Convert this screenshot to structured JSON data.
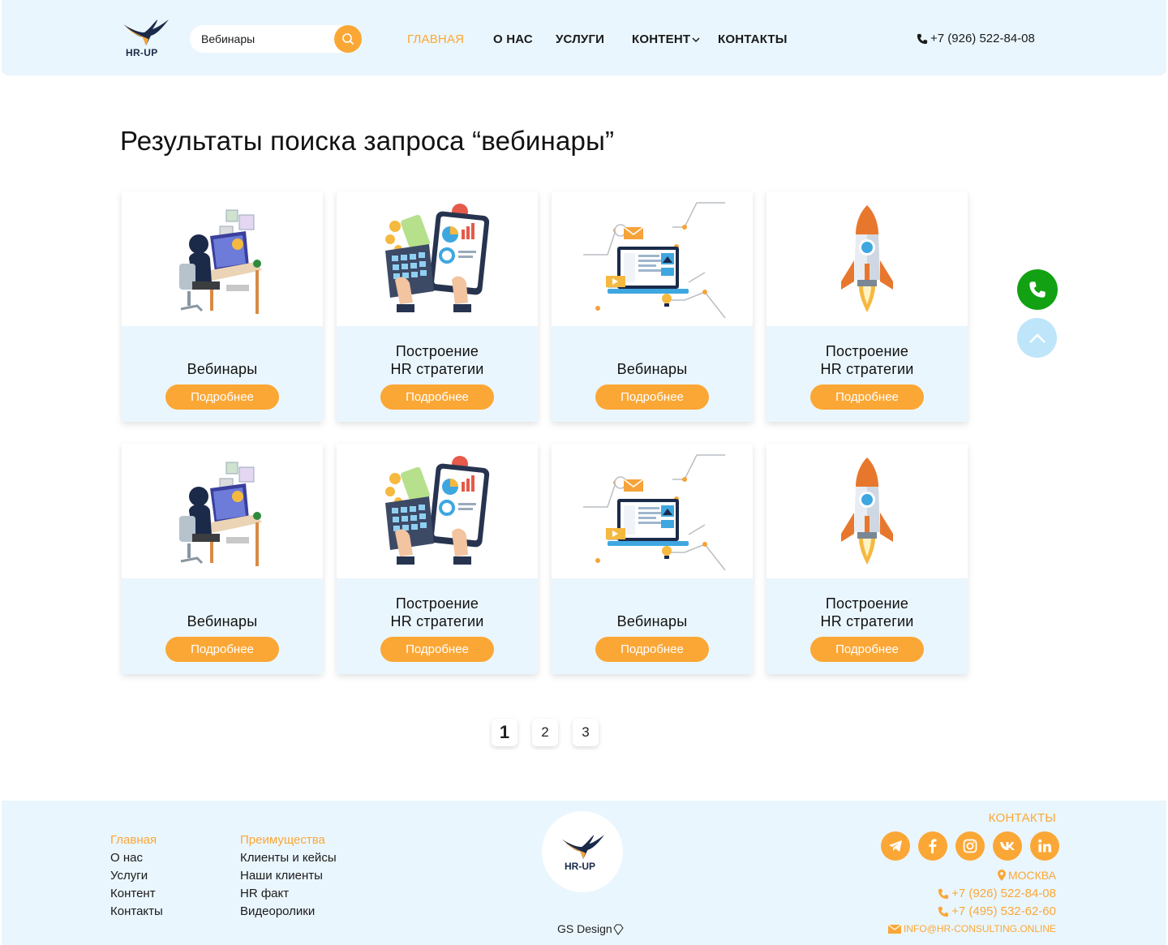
{
  "header": {
    "logo_text": "HR-UP",
    "search": {
      "value": "Вебинары"
    },
    "nav": [
      {
        "label": "ГЛАВНАЯ",
        "active": true
      },
      {
        "label": "О НАС"
      },
      {
        "label": "УСЛУГИ"
      },
      {
        "label": "КОНТЕНТ"
      },
      {
        "label": "КОНТАКТЫ"
      }
    ],
    "phone": "+7 (926) 522-84-08"
  },
  "main": {
    "title": "Результаты поиска запроса “вебинары”",
    "cards": [
      {
        "title": "Вебинары",
        "button": "Подробнее",
        "image": "office-worker-illustration"
      },
      {
        "title": "Построение\nHR стратегии",
        "button": "Подробнее",
        "image": "analytics-tablet-illustration"
      },
      {
        "title": "Вебинары",
        "button": "Подробнее",
        "image": "laptop-network-illustration"
      },
      {
        "title": "Построение\nHR стратегии",
        "button": "Подробнее",
        "image": "rocket-illustration"
      },
      {
        "title": "Вебинары",
        "button": "Подробнее",
        "image": "office-worker-illustration"
      },
      {
        "title": "Построение\nHR стратегии",
        "button": "Подробнее",
        "image": "analytics-tablet-illustration"
      },
      {
        "title": "Вебинары",
        "button": "Подробнее",
        "image": "laptop-network-illustration"
      },
      {
        "title": "Построение\nHR стратегии",
        "button": "Подробнее",
        "image": "rocket-illustration"
      }
    ],
    "pagination": [
      "1",
      "2",
      "3"
    ],
    "current_page": "1"
  },
  "floating": {
    "call_icon": "phone-icon",
    "up_icon": "chevron-up-icon"
  },
  "footer": {
    "col1": [
      "Главная",
      "О нас",
      "Услуги",
      "Контент",
      "Контакты"
    ],
    "col2": [
      "Преимущества",
      "Клиенты и кейсы",
      "Наши клиенты",
      "HR факт",
      "Видеоролики"
    ],
    "logo_text": "HR-UP",
    "credit": "GS Design",
    "contacts_title": "КОНТАКТЫ",
    "socials": [
      "telegram-icon",
      "facebook-icon",
      "instagram-icon",
      "vk-icon",
      "linkedin-icon"
    ],
    "city": "МОСКВА",
    "phone1": "+7 (926) 522-84-08",
    "phone2": "+7 (495) 532-62-60",
    "email": "INFO@HR-CONSULTING.ONLINE"
  },
  "colors": {
    "accent": "#fba736",
    "light_bg": "#eaf6fd",
    "call_green": "#12a112",
    "navy": "#1b2a49"
  }
}
